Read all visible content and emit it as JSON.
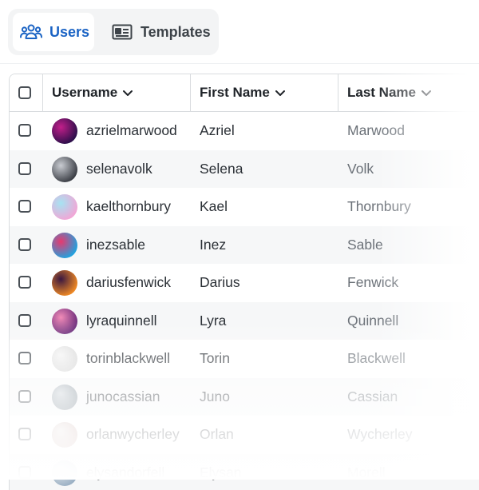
{
  "tabs": {
    "users_label": "Users",
    "templates_label": "Templates",
    "active": "Users",
    "accent": "#1a63c4"
  },
  "table": {
    "columns": [
      "Username",
      "First Name",
      "Last Name"
    ],
    "rows": [
      {
        "username": "azrielmarwood",
        "first": "Azriel",
        "last": "Marwood",
        "avatar_colors": [
          "#2a0e4a",
          "#c21f8a"
        ]
      },
      {
        "username": "selenavolk",
        "first": "Selena",
        "last": "Volk",
        "avatar_colors": [
          "#3a3d44",
          "#c9ccd2"
        ]
      },
      {
        "username": "kaelthornbury",
        "first": "Kael",
        "last": "Thornbury",
        "avatar_colors": [
          "#f2a6d6",
          "#a6e3f2"
        ]
      },
      {
        "username": "inezsable",
        "first": "Inez",
        "last": "Sable",
        "avatar_colors": [
          "#1fa3e0",
          "#e8386e"
        ]
      },
      {
        "username": "dariusfenwick",
        "first": "Darius",
        "last": "Fenwick",
        "avatar_colors": [
          "#f08a24",
          "#3a1740"
        ]
      },
      {
        "username": "lyraquinnell",
        "first": "Lyra",
        "last": "Quinnell",
        "avatar_colors": [
          "#6a2a7a",
          "#f28cb8"
        ]
      },
      {
        "username": "torinblackwell",
        "first": "Torin",
        "last": "Blackwell",
        "avatar_colors": [
          "#d8d8d8",
          "#f4f4f4"
        ]
      },
      {
        "username": "junocassian",
        "first": "Juno",
        "last": "Cassian",
        "avatar_colors": [
          "#7d8a94",
          "#c8d0d6"
        ]
      },
      {
        "username": "orlanwycherley",
        "first": "Orlan",
        "last": "Wycherley",
        "avatar_colors": [
          "#c9a8a4",
          "#e6e1df"
        ]
      },
      {
        "username": "elysandorfell",
        "first": "Elysan",
        "last": "Morell",
        "avatar_colors": [
          "#9bb0c4",
          "#e4e8ec"
        ]
      }
    ]
  }
}
